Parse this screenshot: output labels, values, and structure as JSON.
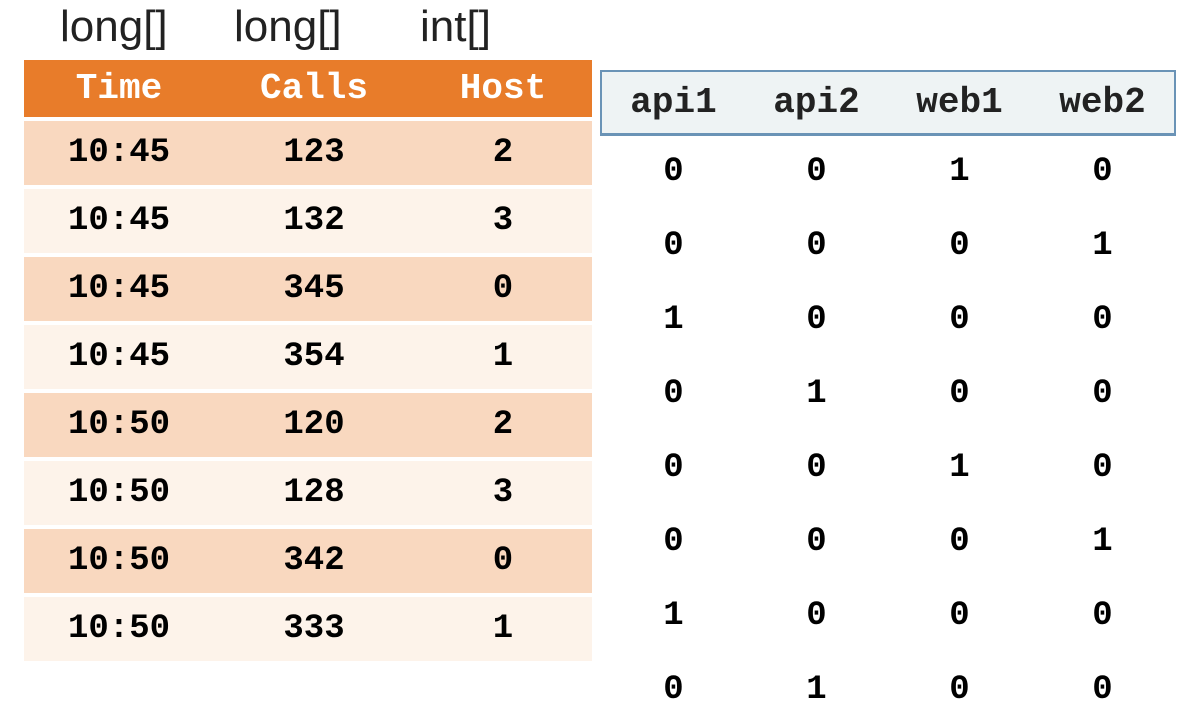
{
  "types": [
    "long[]",
    "long[]",
    "int[]"
  ],
  "main": {
    "headers": [
      "Time",
      "Calls",
      "Host"
    ],
    "rows": [
      [
        "10:45",
        "123",
        "2"
      ],
      [
        "10:45",
        "132",
        "3"
      ],
      [
        "10:45",
        "345",
        "0"
      ],
      [
        "10:45",
        "354",
        "1"
      ],
      [
        "10:50",
        "120",
        "2"
      ],
      [
        "10:50",
        "128",
        "3"
      ],
      [
        "10:50",
        "342",
        "0"
      ],
      [
        "10:50",
        "333",
        "1"
      ]
    ]
  },
  "onehot": {
    "headers": [
      "api1",
      "api2",
      "web1",
      "web2"
    ],
    "rows": [
      [
        "0",
        "0",
        "1",
        "0"
      ],
      [
        "0",
        "0",
        "0",
        "1"
      ],
      [
        "1",
        "0",
        "0",
        "0"
      ],
      [
        "0",
        "1",
        "0",
        "0"
      ],
      [
        "0",
        "0",
        "1",
        "0"
      ],
      [
        "0",
        "0",
        "0",
        "1"
      ],
      [
        "1",
        "0",
        "0",
        "0"
      ],
      [
        "0",
        "1",
        "0",
        "0"
      ]
    ]
  }
}
